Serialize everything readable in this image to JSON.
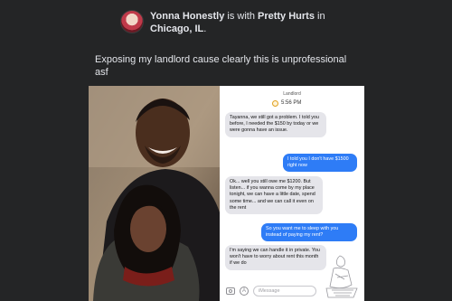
{
  "post": {
    "author": "Yonna Honestly",
    "with_text": " is with ",
    "tagged": "Pretty Hurts",
    "in_text": " in ",
    "location": "Chicago, IL",
    "period": ".",
    "caption_line1": "Exposing my landlord cause clearly this is unprofessional",
    "caption_line2": "asf"
  },
  "chat": {
    "contact": "Landlord",
    "time": "5:56 PM",
    "messages": [
      {
        "dir": "in",
        "text": "Tayanna, we still got a problem. I told you before, I needed the $150 by today or we were gonna have an issue."
      },
      {
        "dir": "out",
        "text": "I told you I don't have $1500 right now"
      },
      {
        "dir": "in",
        "text": "Ok... well you still owe me $1200. But listen... if you wanna come by my place tonight, we can have a little date, spend some time... and we can call it even on the rent"
      },
      {
        "dir": "out",
        "text": "So you want me to sleep with you instead of paying my rent?"
      },
      {
        "dir": "in",
        "text": "I'm saying we can handle it in private. You won't have to worry about rent this month if we do"
      }
    ],
    "input_placeholder": "iMessage",
    "appstore_glyph": "A"
  }
}
